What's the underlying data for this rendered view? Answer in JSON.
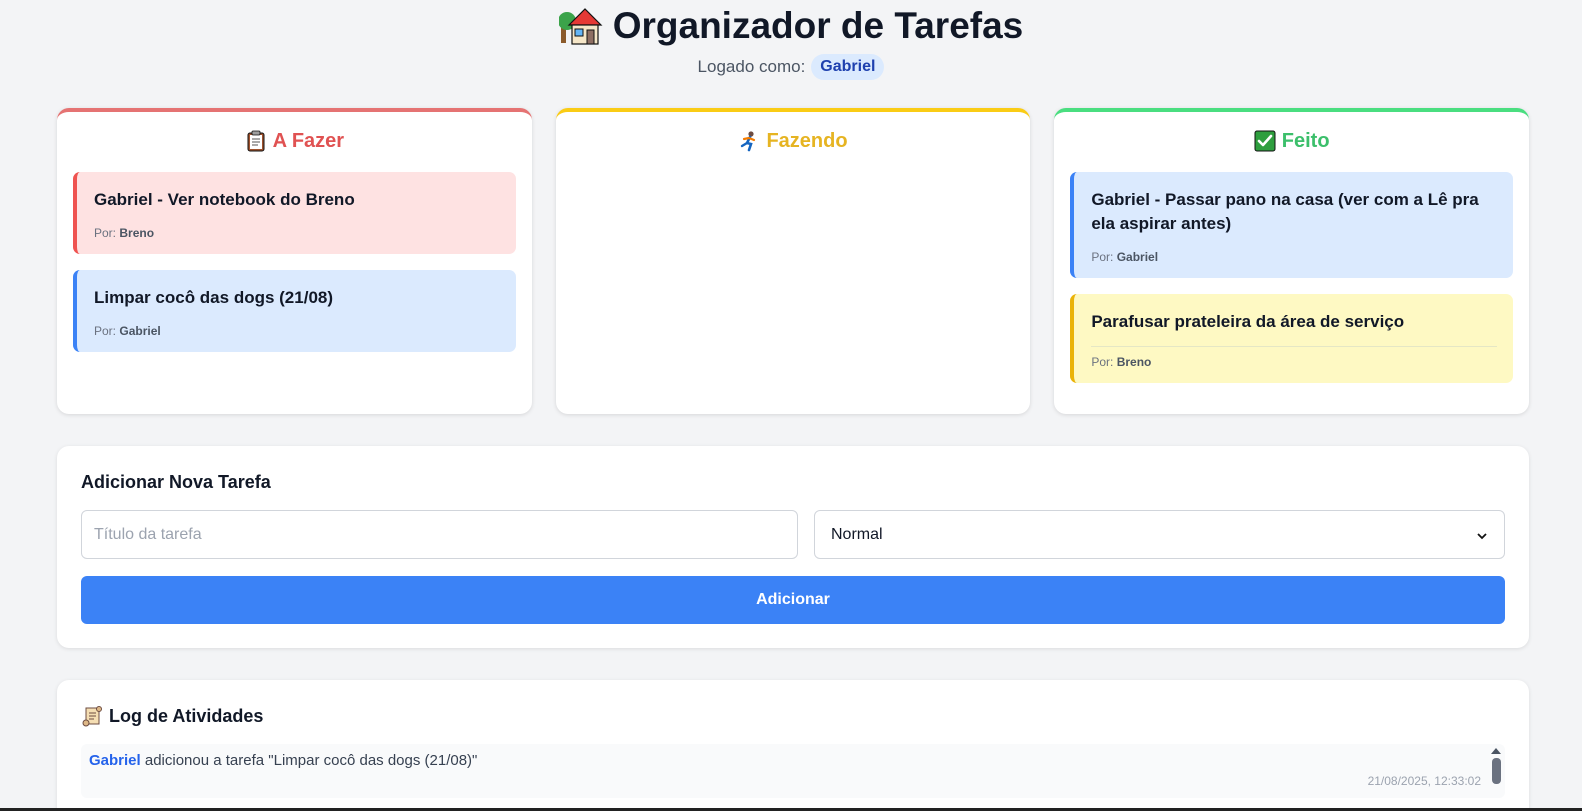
{
  "header": {
    "title": "Organizador de Tarefas",
    "login_label": "Logado como:",
    "user": "Gabriel"
  },
  "columns": {
    "todo": {
      "icon": "clipboard-icon",
      "title": "A Fazer",
      "color": "#e05252",
      "cards": [
        {
          "title": "Gabriel - Ver notebook do Breno",
          "by_label": "Por:",
          "by": "Breno",
          "color": "red"
        },
        {
          "title": "Limpar cocô das dogs (21/08)",
          "by_label": "Por:",
          "by": "Gabriel",
          "color": "blue"
        }
      ]
    },
    "doing": {
      "icon": "running-person-icon",
      "title": "Fazendo",
      "color": "#e6b422",
      "cards": []
    },
    "done": {
      "icon": "check-mark-icon",
      "title": "Feito",
      "color": "#3cbf6b",
      "cards": [
        {
          "title": "Gabriel - Passar pano na casa (ver com a Lê pra ela aspirar antes)",
          "by_label": "Por:",
          "by": "Gabriel",
          "color": "blue"
        },
        {
          "title": "Parafusar prateleira da área de serviço",
          "by_label": "Por:",
          "by": "Breno",
          "color": "yellow"
        }
      ]
    }
  },
  "add_task": {
    "title": "Adicionar Nova Tarefa",
    "title_placeholder": "Título da tarefa",
    "priority_value": "Normal",
    "submit_label": "Adicionar"
  },
  "log": {
    "icon": "scroll-icon",
    "title": "Log de Atividades",
    "entries": [
      {
        "user": "Gabriel",
        "text": "adicionou a tarefa \"Limpar cocô das dogs (21/08)\"",
        "timestamp": "21/08/2025, 12:33:02"
      }
    ]
  },
  "colors": {
    "accent": "#3b82f6",
    "todo_border": "#e57373",
    "doing_border": "#facc15",
    "done_border": "#4ade80"
  }
}
